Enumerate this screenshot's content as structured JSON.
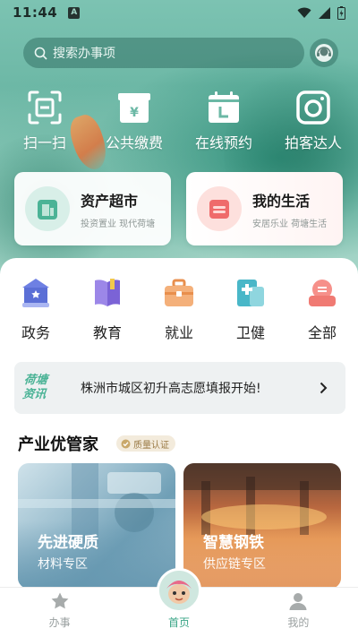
{
  "status_bar": {
    "time": "11:44",
    "app_icon": "A"
  },
  "search": {
    "placeholder": "搜索办事项"
  },
  "quick_actions": [
    {
      "label": "扫一扫",
      "icon": "scan-icon"
    },
    {
      "label": "公共缴费",
      "icon": "wallet-icon"
    },
    {
      "label": "在线预约",
      "icon": "calendar-icon"
    },
    {
      "label": "拍客达人",
      "icon": "camera-icon"
    }
  ],
  "feature_cards": [
    {
      "title": "资产超市",
      "subtitle": "投资置业  现代荷塘",
      "icon": "building-icon",
      "accent": "#4bb396"
    },
    {
      "title": "我的生活",
      "subtitle": "安居乐业  荷塘生活",
      "icon": "sofa-icon",
      "accent": "#ef6b6b"
    }
  ],
  "categories": [
    {
      "label": "政务",
      "icon": "government-icon",
      "color": "#5b6fd6"
    },
    {
      "label": "教育",
      "icon": "book-icon",
      "color": "#8b73e0"
    },
    {
      "label": "就业",
      "icon": "briefcase-icon",
      "color": "#f0a36a"
    },
    {
      "label": "卫健",
      "icon": "medical-icon",
      "color": "#49b7c8"
    },
    {
      "label": "全部",
      "icon": "all-services-icon",
      "color": "#f07a73"
    }
  ],
  "news": {
    "brand_line1": "荷塘",
    "brand_line2": "资讯",
    "headline": "株洲市城区初升高志愿填报开始!"
  },
  "section": {
    "title": "产业优管家",
    "badge": "质量认证"
  },
  "industry_cards": [
    {
      "title": "先进硬质",
      "subtitle": "材料专区"
    },
    {
      "title": "智慧钢铁",
      "subtitle": "供应链专区"
    }
  ],
  "tabbar": [
    {
      "label": "办事",
      "icon": "star-icon",
      "active": false
    },
    {
      "label": "首页",
      "icon": "home-mascot-icon",
      "active": true
    },
    {
      "label": "我的",
      "icon": "person-icon",
      "active": false
    }
  ]
}
